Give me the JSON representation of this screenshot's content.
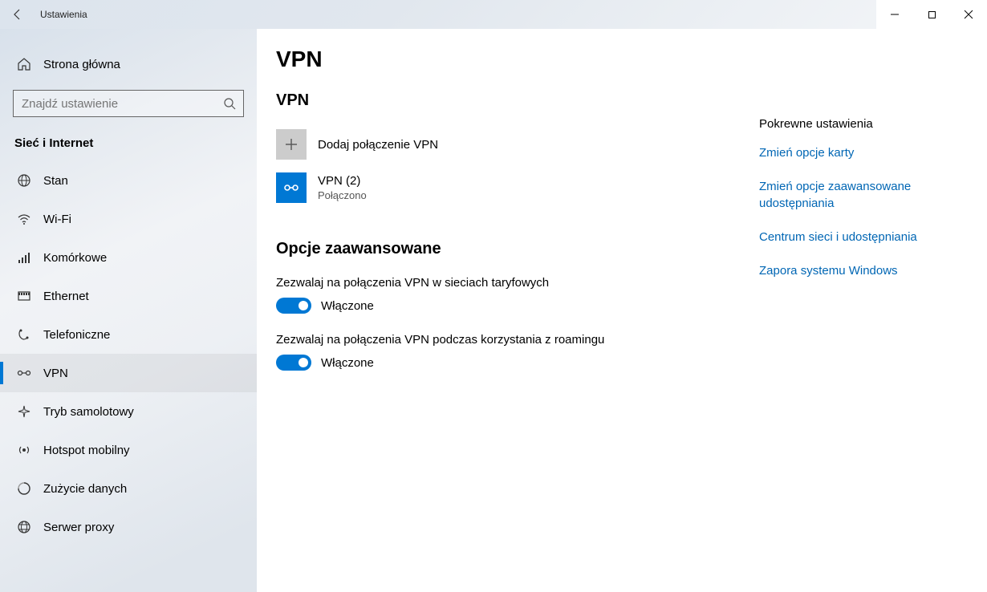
{
  "titlebar": {
    "title": "Ustawienia"
  },
  "sidebar": {
    "home_label": "Strona główna",
    "search_placeholder": "Znajdź ustawienie",
    "category": "Sieć i Internet",
    "items": [
      {
        "label": "Stan"
      },
      {
        "label": "Wi-Fi"
      },
      {
        "label": "Komórkowe"
      },
      {
        "label": "Ethernet"
      },
      {
        "label": "Telefoniczne"
      },
      {
        "label": "VPN"
      },
      {
        "label": "Tryb samolotowy"
      },
      {
        "label": "Hotspot mobilny"
      },
      {
        "label": "Zużycie danych"
      },
      {
        "label": "Serwer proxy"
      }
    ]
  },
  "main": {
    "page_title": "VPN",
    "section_vpn": "VPN",
    "add_vpn_label": "Dodaj połączenie VPN",
    "connection": {
      "name": "VPN (2)",
      "status": "Połączono"
    },
    "advanced_title": "Opcje zaawansowane",
    "toggles": [
      {
        "label": "Zezwalaj na połączenia VPN w sieciach taryfowych",
        "state": "Włączone"
      },
      {
        "label": "Zezwalaj na połączenia VPN podczas korzystania z roamingu",
        "state": "Włączone"
      }
    ]
  },
  "related": {
    "heading": "Pokrewne ustawienia",
    "links": [
      "Zmień opcje karty",
      "Zmień opcje zaawansowane udostępniania",
      "Centrum sieci i udostępniania",
      "Zapora systemu Windows"
    ]
  }
}
